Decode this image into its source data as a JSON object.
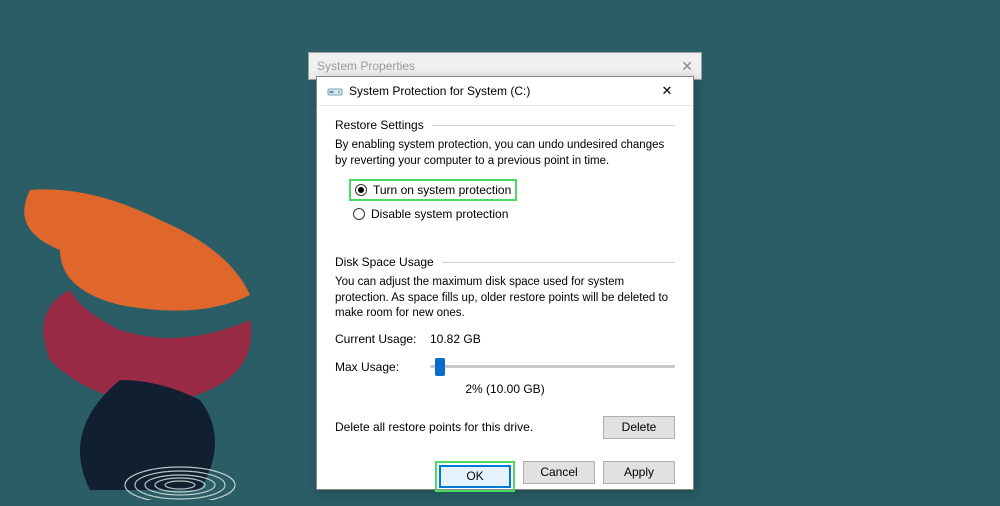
{
  "backWindow": {
    "title": "System Properties"
  },
  "dialog": {
    "title": "System Protection for System (C:)",
    "restore": {
      "header": "Restore Settings",
      "description": "By enabling system protection, you can undo undesired changes by reverting your computer to a previous point in time.",
      "optionOn": "Turn on system protection",
      "optionOff": "Disable system protection",
      "selected": "on"
    },
    "disk": {
      "header": "Disk Space Usage",
      "description": "You can adjust the maximum disk space used for system protection. As space fills up, older restore points will be deleted to make room for new ones.",
      "currentLabel": "Current Usage:",
      "currentValue": "10.82 GB",
      "maxLabel": "Max Usage:",
      "sliderPercent": 2,
      "sliderText": "2% (10.00 GB)"
    },
    "deleteText": "Delete all restore points for this drive.",
    "buttons": {
      "delete": "Delete",
      "ok": "OK",
      "cancel": "Cancel",
      "apply": "Apply"
    }
  }
}
